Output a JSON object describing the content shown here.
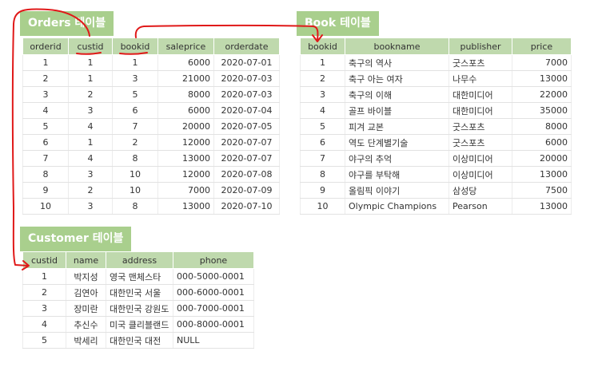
{
  "orders": {
    "title": "Orders 테이블",
    "columns": [
      "orderid",
      "custid",
      "bookid",
      "saleprice",
      "orderdate"
    ],
    "rows": [
      [
        "1",
        "1",
        "1",
        "6000",
        "2020-07-01"
      ],
      [
        "2",
        "1",
        "3",
        "21000",
        "2020-07-03"
      ],
      [
        "3",
        "2",
        "5",
        "8000",
        "2020-07-03"
      ],
      [
        "4",
        "3",
        "6",
        "6000",
        "2020-07-04"
      ],
      [
        "5",
        "4",
        "7",
        "20000",
        "2020-07-05"
      ],
      [
        "6",
        "1",
        "2",
        "12000",
        "2020-07-07"
      ],
      [
        "7",
        "4",
        "8",
        "13000",
        "2020-07-07"
      ],
      [
        "8",
        "3",
        "10",
        "12000",
        "2020-07-08"
      ],
      [
        "9",
        "2",
        "10",
        "7000",
        "2020-07-09"
      ],
      [
        "10",
        "3",
        "8",
        "13000",
        "2020-07-10"
      ]
    ]
  },
  "book": {
    "title": "Book 테이블",
    "columns": [
      "bookid",
      "bookname",
      "publisher",
      "price"
    ],
    "rows": [
      [
        "1",
        "축구의 역사",
        "굿스포츠",
        "7000"
      ],
      [
        "2",
        "축구 아는 여자",
        "나무수",
        "13000"
      ],
      [
        "3",
        "축구의 이해",
        "대한미디어",
        "22000"
      ],
      [
        "4",
        "골프 바이블",
        "대한미디어",
        "35000"
      ],
      [
        "5",
        "피겨 교본",
        "굿스포츠",
        "8000"
      ],
      [
        "6",
        "역도 단계별기술",
        "굿스포츠",
        "6000"
      ],
      [
        "7",
        "야구의 추억",
        "이상미디어",
        "20000"
      ],
      [
        "8",
        "야구를 부탁해",
        "이상미디어",
        "13000"
      ],
      [
        "9",
        "올림픽 이야기",
        "삼성당",
        "7500"
      ],
      [
        "10",
        "Olympic Champions",
        "Pearson",
        "13000"
      ]
    ]
  },
  "customer": {
    "title": "Customer 테이블",
    "columns": [
      "custid",
      "name",
      "address",
      "phone"
    ],
    "rows": [
      [
        "1",
        "박지성",
        "영국 맨체스타",
        "000-5000-0001"
      ],
      [
        "2",
        "김연아",
        "대한민국 서울",
        "000-6000-0001"
      ],
      [
        "3",
        "장미란",
        "대한민국 강원도",
        "000-7000-0001"
      ],
      [
        "4",
        "추신수",
        "미국 클리블랜드",
        "000-8000-0001"
      ],
      [
        "5",
        "박세리",
        "대한민국 대전",
        "NULL"
      ]
    ]
  },
  "colors": {
    "title_badge": "#a9cf8d",
    "header_row": "#bfd9ad",
    "annotation_ink": "#e01919"
  }
}
